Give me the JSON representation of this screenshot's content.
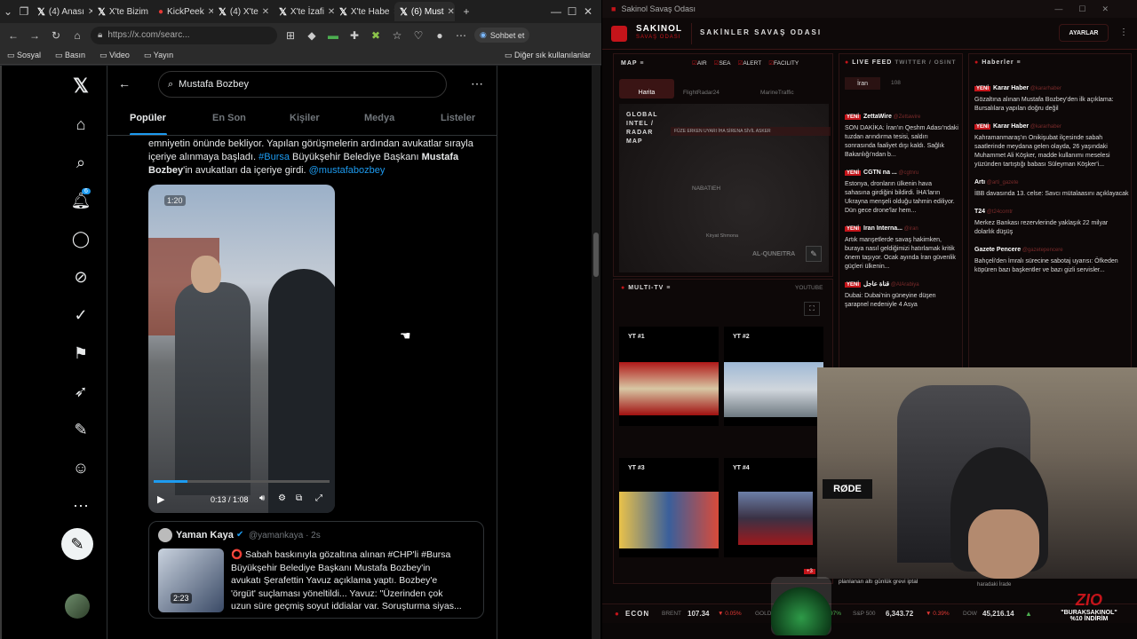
{
  "browser": {
    "tabs": [
      "(4) Anası",
      "X'te Bizim",
      "KickPeek",
      "(4) X'te",
      "X'te İzafi",
      "X'te Habe",
      "(6) Must"
    ],
    "url": "https://x.com/searc...",
    "copilot": "Sohbet et",
    "bookmarks": [
      "Sosyal",
      "Basın",
      "Video",
      "Yayın"
    ],
    "other_bookmarks": "Diğer sık kullanılanlar"
  },
  "x": {
    "search_value": "Mustafa Bozbey",
    "tabs": [
      "Popüler",
      "En Son",
      "Kişiler",
      "Medya",
      "Listeler"
    ],
    "notif_count": "6",
    "tweet": {
      "line1": "emniyetin önünde bekliyor. Yapılan görüşmelerin ardından avukatlar sırayla",
      "line2_pre": "içeriye alınmaya başladı. ",
      "hashtag": "#Bursa",
      "line2_post": " Büyükşehir Belediye Başkanı ",
      "bold": "Mustafa",
      "line3_bold": "Bozbey",
      "line3": "'in avukatları da içeriye girdi. ",
      "mention": "@mustafabozbey"
    },
    "video": {
      "badge": "1:20",
      "time": "0:13 / 1:08"
    },
    "quote": {
      "name": "Yaman Kaya",
      "handle": "@yamankaya · 2s",
      "duration": "2:23",
      "l1": "⭕ Sabah baskınıyla gözaltına alınan #CHP'li #Bursa",
      "l2": "Büyükşehir Belediye Başkanı Mustafa Bozbey'in",
      "l3": "avukatı Şerafettin Yavuz açıklama yaptı. Bozbey'e",
      "l4": "'örgüt' suçlaması yöneltildi... Yavuz: \"Üzerinden çok",
      "l5": "uzun süre geçmiş soyut iddialar var. Soruşturma siyas..."
    }
  },
  "app": {
    "window_title": "Sakinol Savaş Odası",
    "brand": "SAKINOL",
    "brand_sub": "SAVAŞ ODASI",
    "heading": "SAKİNLER SAVAŞ ODASI",
    "settings": "AYARLAR",
    "map": {
      "label": "MAP",
      "filters": [
        "AIR",
        "SEA",
        "ALERT",
        "FACILITY"
      ],
      "tabs": [
        "Harita",
        "FlightRadar24",
        "MarineTraffic"
      ],
      "overlay": "GLOBAL INTEL / RADAR MAP",
      "legend": "FÜZE  ERKEN UYARI  İHA  SİRENA  SİVİL  ASKER",
      "places": [
        "NABATIEH",
        "Kiryat Shmona",
        "AL-QUNEITRA"
      ]
    },
    "multitv": {
      "label": "MULTI-TV",
      "source": "YOUTUBE",
      "boxes": [
        "YT #1",
        "YT #2",
        "YT #3",
        "YT #4"
      ],
      "more": "+3"
    },
    "livefeed": {
      "label": "LIVE FEED",
      "sub": "TWITTER / OSINT",
      "filter": "İran",
      "count": "108",
      "items": [
        {
          "tag": "YENİ",
          "src": "ZettaWire",
          "handle": "@Zettawire",
          "text": "SON DAKİKA: İran'ın Qeshm Adası'ndaki tuzdan arındırma tesisi, saldırı sonrasında faaliyet dışı kaldı. Sağlık Bakanlığı'ndan b..."
        },
        {
          "tag": "YENİ",
          "src": "CGTN na ...",
          "handle": "@cgtnru",
          "text": "Estonya, dronların ülkenin hava sahasına girdiğini bildirdi. İHA'ların Ukrayna menşeli olduğu tahmin ediliyor. Dün gece drone'lar hem..."
        },
        {
          "tag": "YENİ",
          "src": "Iran Interna...",
          "handle": "@iran",
          "text": "Artık manşetlerde savaş hakimken, buraya nasıl geldiğimizi hatırlamak kritik önem taşıyor. Ocak ayında İran güvenlik güçleri ülkenin..."
        },
        {
          "tag": "YENİ",
          "src": "قناة عاجل",
          "handle": "@AlArabiya",
          "text": "Dubai: Dubai'nin güneyine düşen şarapnel nedeniyle 4 Asya"
        }
      ]
    },
    "haberler": {
      "label": "Haberler",
      "items": [
        {
          "tag": "YENİ",
          "src": "Karar Haber",
          "handle": "@kararhaber",
          "text": "Gözaltına alınan Mustafa Bozbey'den ilk açıklama: Bursalılara yapılan doğru değil"
        },
        {
          "tag": "YENİ",
          "src": "Karar Haber",
          "handle": "@kararhaber",
          "text": "Kahramanmaraş'ın Onikişubat ilçesinde sabah saatlerinde meydana gelen olayda, 26 yaşındaki Muhammet Ali Köşker, madde kullanımı meselesi yüzünden tartıştığı babası Süleyman Köşker'i..."
        },
        {
          "tag": "",
          "src": "Artı",
          "handle": "@arti_gazete",
          "text": "İBB davasında 13. celse: Savcı mütalaasını açıklayacak"
        },
        {
          "tag": "",
          "src": "T24",
          "handle": "@t24comtr",
          "text": "Merkez Bankası rezervlerinde yaklaşık 22 milyar dolarlık düşüş"
        },
        {
          "tag": "",
          "src": "Gazete Pencere",
          "handle": "@gazetepencere",
          "text": "Bahçeli'den İmralı sürecine sabotaj uyarısı: Öfkeden köpüren bazı başkentler ve bazı gizli servisler..."
        }
      ]
    },
    "econ": {
      "label": "ECON",
      "brent_l": "BRENT",
      "brent": "107.34",
      "brent_ch": "▼ 0.05%",
      "gold_l": "GOLD",
      "gold_ch": "97%",
      "sp_l": "S&P 500",
      "sp": "6,343.72",
      "sp_ch": "▼ 0.39%",
      "dow_l": "DOW",
      "dow": "45,216.14",
      "dow_ch": "▲"
    },
    "ticker_bits": [
      "planlanan altı günlük grevi iptal",
      "haradaki İrade"
    ],
    "promo": {
      "logo": "ZIO",
      "code": "\"BURAKSAKINOL\"",
      "discount": "%10 İNDİRİM"
    }
  },
  "colors": {
    "x_blue": "#1d9bf0",
    "accent_red": "#c4141a"
  }
}
